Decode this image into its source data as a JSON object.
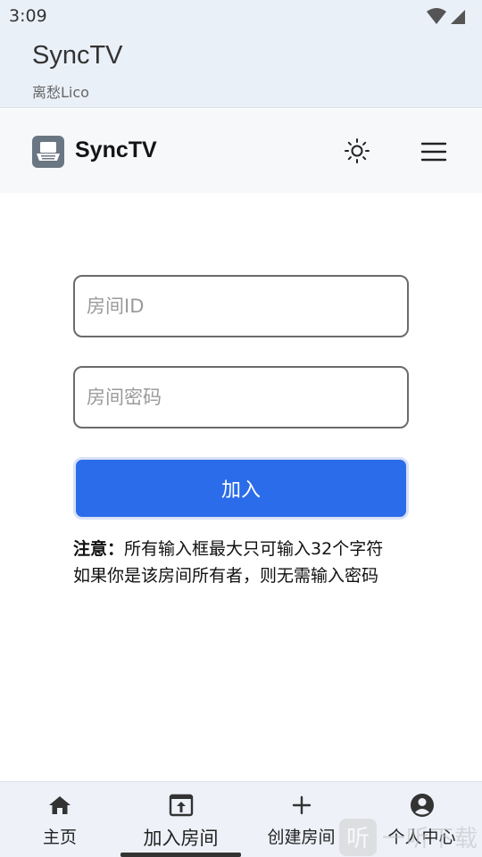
{
  "status_bar": {
    "time": "3:09"
  },
  "app_bar": {
    "title": "SyncTV",
    "subtitle": "离愁Lico"
  },
  "nav": {
    "brand": "SyncTV"
  },
  "form": {
    "room_id_placeholder": "房间ID",
    "room_id_value": "",
    "room_password_placeholder": "房间密码",
    "room_password_value": "",
    "join_label": "加入"
  },
  "notes": {
    "label": "注意：",
    "line1": "所有输入框最大只可输入32个字符",
    "line2": "如果你是该房间所有者，则无需输入密码"
  },
  "bottom_nav": {
    "items": [
      {
        "label": "主页",
        "icon": "home-icon",
        "active": false
      },
      {
        "label": "加入房间",
        "icon": "join-room-icon",
        "active": true
      },
      {
        "label": "创建房间",
        "icon": "plus-icon",
        "active": false
      },
      {
        "label": "个人中心",
        "icon": "account-icon",
        "active": false
      }
    ]
  },
  "watermark": {
    "badge": "听",
    "text": "一听下载"
  },
  "colors": {
    "primary": "#2b6cea",
    "app_bar_bg": "#eaf0f8",
    "bottom_nav_bg": "#eef1f8"
  }
}
